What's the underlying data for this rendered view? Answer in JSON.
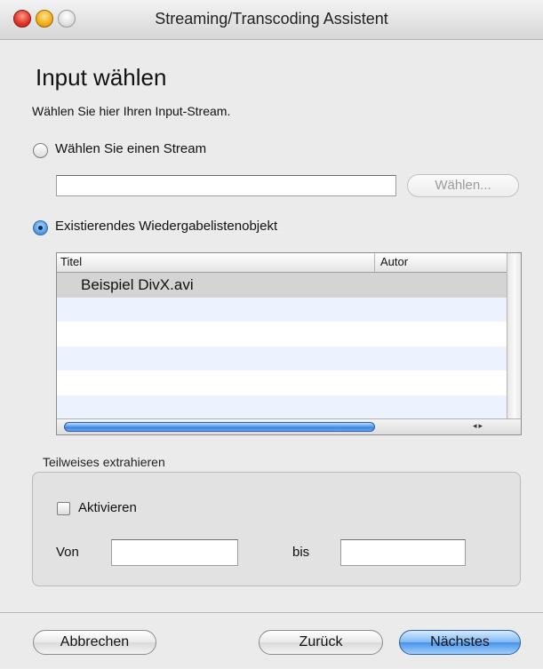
{
  "window": {
    "title": "Streaming/Transcoding Assistent"
  },
  "page": {
    "heading": "Input wählen",
    "subtitle": "Wählen Sie hier Ihren Input-Stream."
  },
  "stream_option": {
    "label": "Wählen Sie einen Stream",
    "selected": false,
    "input_value": "",
    "choose_button": "Wählen...",
    "choose_button_enabled": false
  },
  "playlist_option": {
    "label": "Existierendes Wiedergabelistenobjekt",
    "selected": true
  },
  "playlist_table": {
    "columns": [
      "Titel",
      "Autor"
    ],
    "rows": [
      {
        "title": "Beispiel DivX.avi",
        "author": "",
        "selected": true
      }
    ]
  },
  "partial_extract": {
    "group_title": "Teilweises extrahieren",
    "enable_label": "Aktivieren",
    "enabled": false,
    "from_label": "Von",
    "from_value": "",
    "to_label": "bis",
    "to_value": ""
  },
  "buttons": {
    "cancel": "Abbrechen",
    "back": "Zurück",
    "next": "Nächstes"
  },
  "colors": {
    "accent": "#4a93ea",
    "selected_row": "#d4d4d4",
    "alt_row": "#edf3fe"
  }
}
